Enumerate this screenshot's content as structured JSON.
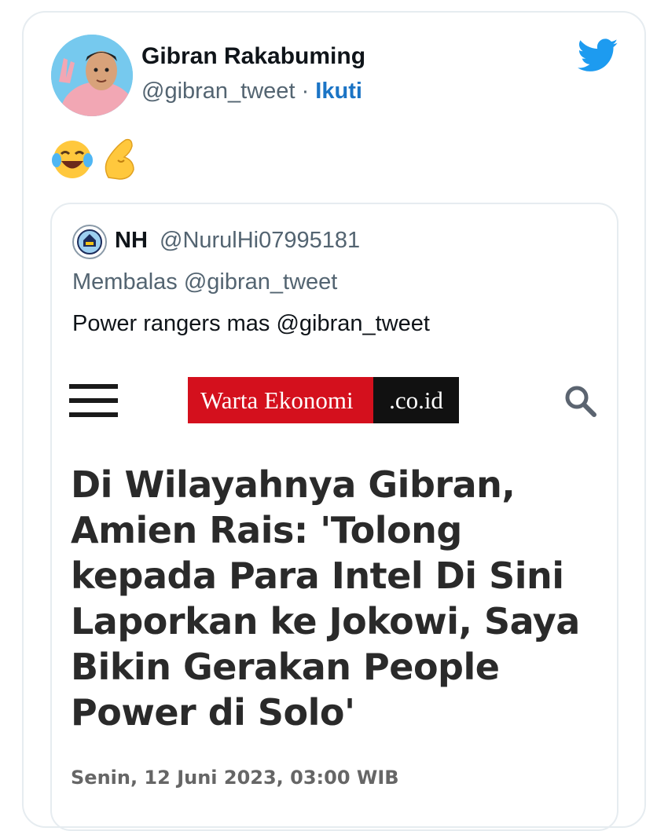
{
  "tweet": {
    "author_name": "Gibran Rakabuming",
    "handle": "@gibran_tweet",
    "separator": "·",
    "follow_label": "Ikuti",
    "emojis": [
      "face-with-tears-of-joy",
      "pinched-fingers"
    ]
  },
  "quoted_tweet": {
    "author_name": "NH",
    "handle": "@NurulHi07995181",
    "reply_prefix": "Membalas @gibran_tweet",
    "text": "Power rangers mas @gibran_tweet"
  },
  "article": {
    "site_name": "Warta Ekonomi",
    "site_tld": ".co.id",
    "headline_lines": [
      "Di Wilayahnya Gibran,",
      "Amien Rais: 'Tolong",
      "kepada Para Intel Di Sini",
      "Laporkan ke Jokowi, Saya",
      "Bikin Gerakan People",
      "Power di Solo'"
    ],
    "date": "Senin, 12 Juni 2023, 03:00 WIB"
  },
  "icons": [
    "twitter-bird-icon",
    "menu-icon",
    "search-icon",
    "club-crest-icon"
  ],
  "colors": {
    "follow": "#1b74c5",
    "twitter_blue": "#1d9bf0",
    "logo_red": "#d4101d",
    "muted": "#536471"
  }
}
